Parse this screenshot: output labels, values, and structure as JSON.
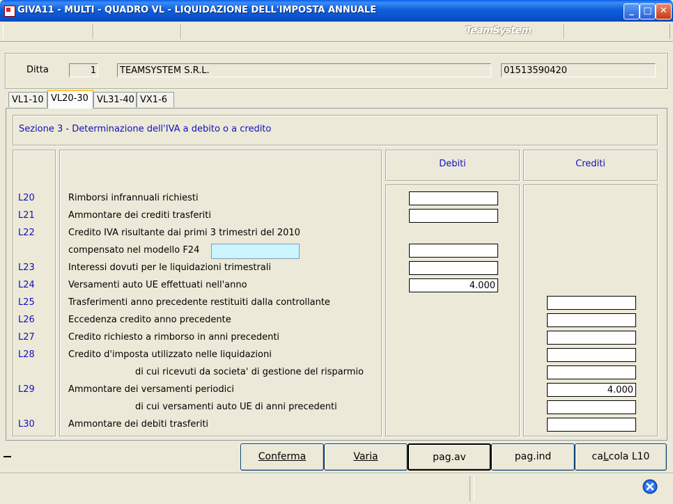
{
  "window": {
    "title": "GIVA11  - MULTI -  QUADRO VL - LIQUIDAZIONE DELL'IMPOSTA ANNUALE",
    "minimize": "_",
    "maximize": "□",
    "close": "✕"
  },
  "brand": "TeamSystem",
  "header": {
    "ditta_label": "Ditta",
    "ditta_code": "1",
    "company_name": "TEAMSYSTEM S.R.L.",
    "vat_number": "01513590420"
  },
  "tabs": [
    {
      "label": "VL1-10",
      "active": false
    },
    {
      "label": "VL20-30",
      "active": true
    },
    {
      "label": "VL31-40",
      "active": false
    },
    {
      "label": "VX1-6",
      "active": false
    }
  ],
  "section_title": "Sezione 3 - Determinazione dell'IVA a debito o a credito",
  "columns": {
    "debiti": "Debiti",
    "crediti": "Crediti"
  },
  "rows": [
    {
      "code": "L20",
      "label": "Rimborsi infrannuali richiesti",
      "debiti": "",
      "crediti": null
    },
    {
      "code": "L21",
      "label": "Ammontare dei crediti trasferiti",
      "debiti": "",
      "crediti": null
    },
    {
      "code": "L22",
      "label": "Credito IVA risultante dai primi 3 trimestri del 2010",
      "debiti": null,
      "crediti": null
    },
    {
      "code": "",
      "label": "compensato nel modello F24",
      "debiti": "",
      "crediti": null,
      "extra": ""
    },
    {
      "code": "L23",
      "label": "Interessi dovuti per le liquidazioni trimestrali",
      "debiti": "",
      "crediti": null
    },
    {
      "code": "L24",
      "label": "Versamenti auto UE effettuati nell'anno",
      "debiti": "4.000",
      "crediti": null
    },
    {
      "code": "L25",
      "label": "Trasferimenti anno precedente restituiti dalla controllante",
      "debiti": null,
      "crediti": ""
    },
    {
      "code": "L26",
      "label": "Eccedenza credito anno precedente",
      "debiti": null,
      "crediti": ""
    },
    {
      "code": "L27",
      "label": "Credito richiesto a rimborso in anni precedenti",
      "debiti": null,
      "crediti": ""
    },
    {
      "code": "L28",
      "label": "Credito d'imposta utilizzato nelle liquidazioni",
      "debiti": null,
      "crediti": ""
    },
    {
      "code": "",
      "label": "di cui ricevuti da societa' di gestione del risparmio",
      "debiti": null,
      "crediti": "",
      "indent": true
    },
    {
      "code": "L29",
      "label": "Ammontare dei versamenti periodici",
      "debiti": null,
      "crediti": "4.000"
    },
    {
      "code": "",
      "label": "di cui versamenti auto UE di anni precedenti",
      "debiti": null,
      "crediti": "",
      "indent": true
    },
    {
      "code": "L30",
      "label": "Ammontare dei debiti trasferiti",
      "debiti": null,
      "crediti": ""
    }
  ],
  "buttons": {
    "conferma": "Conferma",
    "varia": "Varia",
    "pag_av": "pag.av",
    "pag_ind": "pag.ind",
    "calcola_pre": "ca",
    "calcola_key": "L",
    "calcola_post": "cola L10"
  },
  "colors": {
    "accent_blue": "#1010c0",
    "titlebar": "#0a5ee8",
    "cyan_field": "#ccf5ff"
  },
  "icons": {
    "app": "app-icon",
    "exit": "exit-icon"
  }
}
